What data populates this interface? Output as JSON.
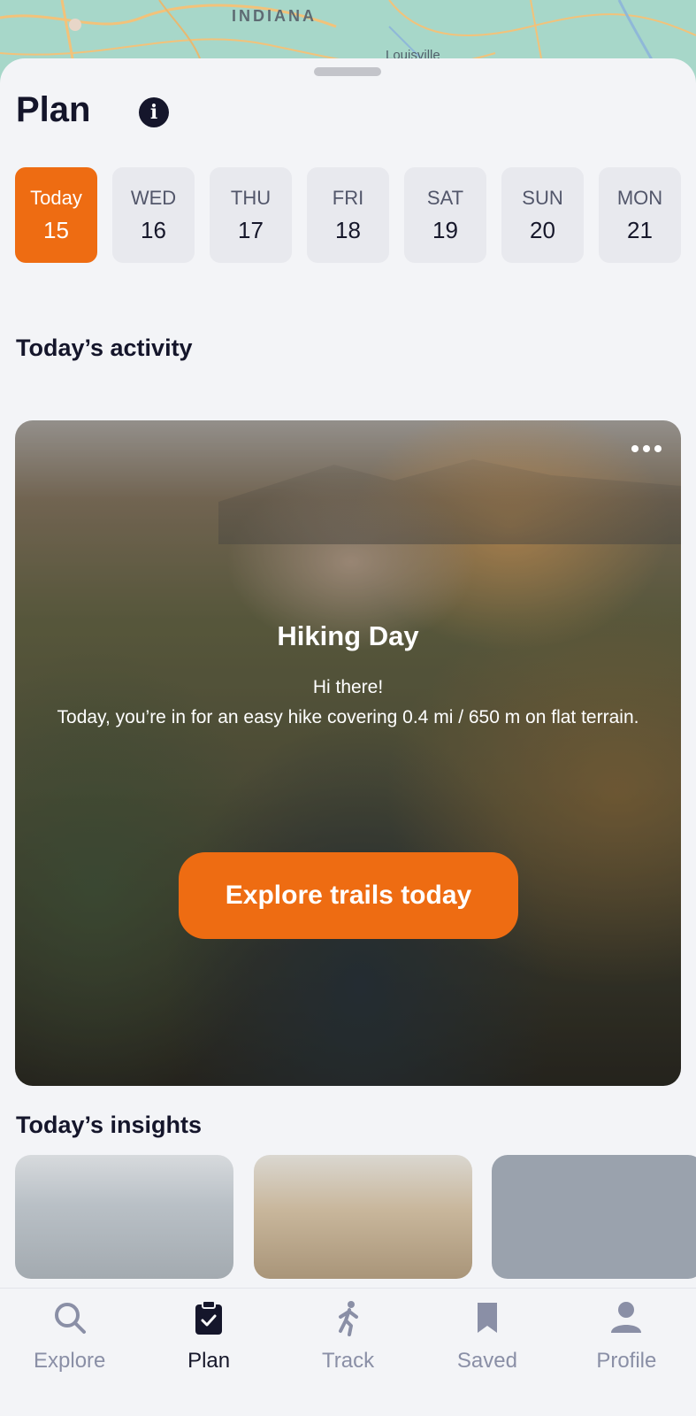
{
  "map": {
    "region_label": "INDIANA",
    "city_label": "Louisville"
  },
  "header": {
    "title": "Plan"
  },
  "days": [
    {
      "name": "Today",
      "num": "15",
      "active": true
    },
    {
      "name": "WED",
      "num": "16",
      "active": false
    },
    {
      "name": "THU",
      "num": "17",
      "active": false
    },
    {
      "name": "FRI",
      "num": "18",
      "active": false
    },
    {
      "name": "SAT",
      "num": "19",
      "active": false
    },
    {
      "name": "SUN",
      "num": "20",
      "active": false
    },
    {
      "name": "MON",
      "num": "21",
      "active": false
    }
  ],
  "activity": {
    "section_title": "Today’s activity",
    "heading": "Hiking Day",
    "greeting": "Hi there!",
    "description": "Today, you’re in for an easy hike covering 0.4 mi / 650 m on flat terrain.",
    "cta_label": "Explore trails today"
  },
  "insights": {
    "section_title": "Today’s insights"
  },
  "nav": {
    "items": [
      {
        "label": "Explore",
        "icon": "search-icon",
        "active": false
      },
      {
        "label": "Plan",
        "icon": "clipboard-check-icon",
        "active": true
      },
      {
        "label": "Track",
        "icon": "walking-person-icon",
        "active": false
      },
      {
        "label": "Saved",
        "icon": "bookmark-icon",
        "active": false
      },
      {
        "label": "Profile",
        "icon": "person-icon",
        "active": false
      }
    ]
  },
  "colors": {
    "accent": "#ee6c12",
    "ink": "#15162b",
    "muted": "#8a8fa6",
    "background": "#f3f4f7"
  }
}
